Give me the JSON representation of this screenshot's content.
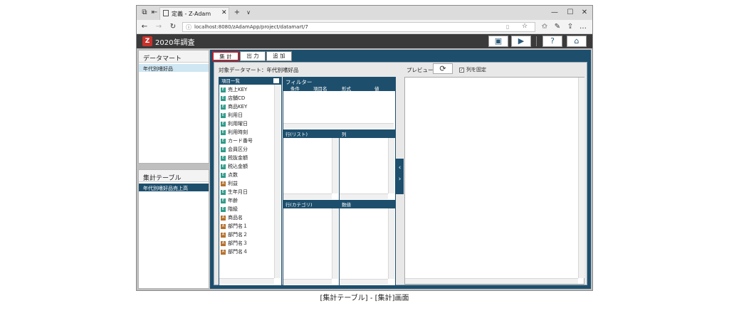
{
  "browser": {
    "tab_title": "定義 - Z-Adam",
    "new_tab": "+",
    "tab_menu": "∨",
    "url": "localhost:8080/zAdamApp/project/datamart/7",
    "window_min": "—",
    "window_max": "☐",
    "window_close": "✕"
  },
  "app": {
    "title": "2020年調査",
    "colors": {
      "header": "#3a3a3a",
      "accent": "#1d4f6d",
      "selected": "#cfe6f3",
      "selected_dark": "#1d4f6d"
    }
  },
  "sidebar": {
    "datamart_header": "データマート",
    "datamart_items": [
      {
        "label": "年代別嗜好品"
      }
    ],
    "table_header": "集計テーブル",
    "table_items": [
      {
        "label": "年代別嗜好品売上高"
      }
    ]
  },
  "tabs": [
    {
      "label": "集 計"
    },
    {
      "label": "出 力"
    },
    {
      "label": "追 加"
    }
  ],
  "main": {
    "target_label": "対象データマート：年代別嗜好品",
    "items_header": "項目一覧",
    "items": [
      {
        "type": "E",
        "label": "売上KEY"
      },
      {
        "type": "E",
        "label": "店舗CD"
      },
      {
        "type": "E",
        "label": "商品KEY"
      },
      {
        "type": "E",
        "label": "利用日"
      },
      {
        "type": "E",
        "label": "利用曜日"
      },
      {
        "type": "E",
        "label": "利用時刻"
      },
      {
        "type": "E",
        "label": "カード番号"
      },
      {
        "type": "E",
        "label": "会員区分"
      },
      {
        "type": "E",
        "label": "税抜金額"
      },
      {
        "type": "E",
        "label": "税込金額"
      },
      {
        "type": "E",
        "label": "点数"
      },
      {
        "type": "A",
        "label": "利益"
      },
      {
        "type": "E",
        "label": "生年月日"
      },
      {
        "type": "E",
        "label": "年齢"
      },
      {
        "type": "E",
        "label": "階級"
      },
      {
        "type": "A",
        "label": "商品名"
      },
      {
        "type": "A",
        "label": "部門名１"
      },
      {
        "type": "A",
        "label": "部門名２"
      },
      {
        "type": "A",
        "label": "部門名３"
      },
      {
        "type": "A",
        "label": "部門名４"
      }
    ],
    "filter_label": "フィルター",
    "filter_columns": [
      "条件",
      "項目名",
      "形式",
      "値"
    ],
    "rows_list_label": "行(リスト)",
    "cols_label": "列",
    "rows_category_label": "行(カテゴリ)",
    "values_label": "数値",
    "preview_label": "プレビュー",
    "fix_columns_label": "列を固定"
  },
  "caption": "[集計テーブル] - [集計]画面"
}
